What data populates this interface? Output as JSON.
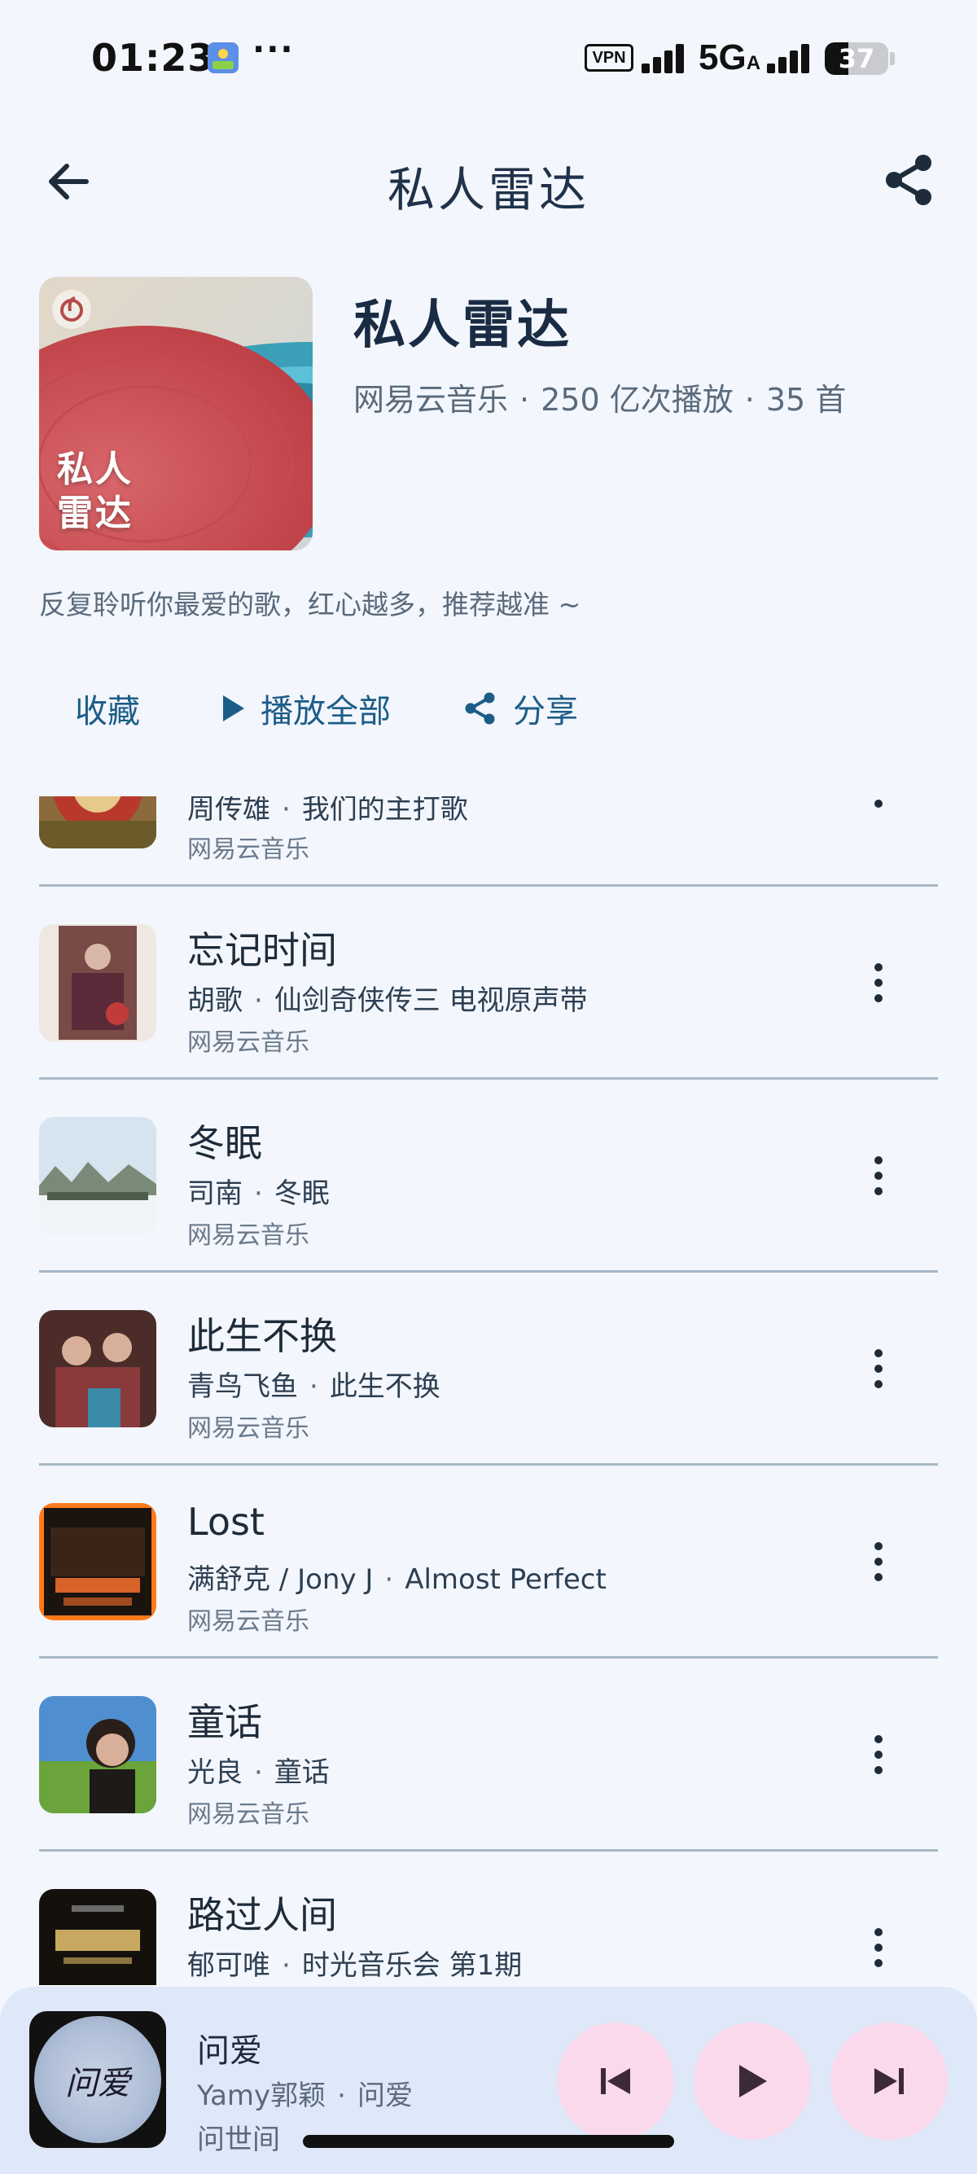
{
  "status_bar": {
    "time": "01:23",
    "more": "···",
    "vpn": "VPN",
    "network": "5G",
    "network_suffix": "A",
    "battery": "37",
    "battery_level": 0.37
  },
  "top_bar": {
    "title": "私人雷达",
    "back_icon": "arrow-left-icon",
    "share_icon": "share-icon"
  },
  "playlist": {
    "cover_text_line1": "私人",
    "cover_text_line2": "雷达",
    "name": "私人雷达",
    "creator": "网易云音乐",
    "plays": "250 亿次播放",
    "count": "35 首",
    "description": "反复聆听你最爱的歌，红心越多，推荐越准 ~"
  },
  "actions": {
    "collect": "收藏",
    "play_all": "播放全部",
    "share": "分享"
  },
  "songs": [
    {
      "title": "",
      "artist": "周传雄",
      "album": "我们的主打歌",
      "source": "网易云音乐"
    },
    {
      "title": "忘记时间",
      "artist": "胡歌",
      "album": "仙剑奇侠传三 电视原声带",
      "source": "网易云音乐"
    },
    {
      "title": "冬眠",
      "artist": "司南",
      "album": "冬眠",
      "source": "网易云音乐"
    },
    {
      "title": "此生不换",
      "artist": "青鸟飞鱼",
      "album": "此生不换",
      "source": "网易云音乐"
    },
    {
      "title": "Lost",
      "artist": "满舒克 / Jony J",
      "album": "Almost Perfect",
      "source": "网易云音乐"
    },
    {
      "title": "童话",
      "artist": "光良",
      "album": "童话",
      "source": "网易云音乐"
    },
    {
      "title": "路过人间",
      "artist": "郁可唯",
      "album": "时光音乐会 第1期",
      "source": ""
    }
  ],
  "now_playing": {
    "title": "问爱",
    "artist": "Yamy郭颖",
    "album": "问爱",
    "extra": "问世间",
    "cover_text": "问爱"
  },
  "colors": {
    "background": "#f3f6fc",
    "accent": "#1c5d88",
    "control_bg": "#fbd9ec",
    "player_bg": "#dfe8f8"
  }
}
